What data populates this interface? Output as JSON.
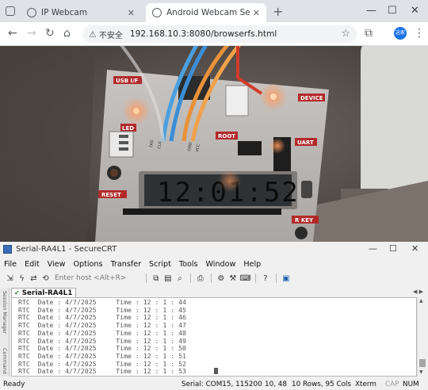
{
  "browser": {
    "tabs": [
      {
        "title": "IP Webcam",
        "active": false
      },
      {
        "title": "Android Webcam Server",
        "active": true
      }
    ],
    "url": "192.168.10.3:8080/browserfs.html",
    "security_label": "不安全",
    "avatar_text": "这家",
    "icons": {
      "back": "back-arrow-icon",
      "forward": "forward-arrow-icon",
      "reload": "reload-icon",
      "home": "home-icon",
      "bookmark": "star-icon",
      "extensions": "puzzle-icon",
      "menu": "kebab-menu-icon"
    }
  },
  "webcam": {
    "board_labels": {
      "usb": "USB I/F",
      "led": "LED",
      "device": "DEVICE",
      "root": "ROOT",
      "uart": "UART",
      "reset": "RESET",
      "key": "R KEY",
      "dio": "DIO",
      "clk": "CLK",
      "gnd": "GND",
      "vcc": "VCC"
    },
    "lcd_text": "12:01:52"
  },
  "crt": {
    "window_title": "Serial-RA4L1 - SecureCRT",
    "menu": [
      "File",
      "Edit",
      "View",
      "Options",
      "Transfer",
      "Script",
      "Tools",
      "Window",
      "Help"
    ],
    "host_placeholder": "Enter host <Alt+R>",
    "session_manager_label": "Session Manager",
    "command_manager_label": "Command",
    "session_tab": "Serial-RA4L1",
    "terminal_lines": [
      "RTC  Date : 4/7/2025     Time : 12 : 1 : 44",
      "RTC  Date : 4/7/2025     Time : 12 : 1 : 45",
      "RTC  Date : 4/7/2025     Time : 12 : 1 : 46",
      "RTC  Date : 4/7/2025     Time : 12 : 1 : 47",
      "RTC  Date : 4/7/2025     Time : 12 : 1 : 48",
      "RTC  Date : 4/7/2025     Time : 12 : 1 : 49",
      "RTC  Date : 4/7/2025     Time : 12 : 1 : 50",
      "RTC  Date : 4/7/2025     Time : 12 : 1 : 51",
      "RTC  Date : 4/7/2025     Time : 12 : 1 : 52",
      "RTC  Date : 4/7/2025     Time : 12 : 1 : 53"
    ],
    "status": {
      "ready": "Ready",
      "serial": "Serial: COM15, 115200",
      "position": "10,  48",
      "size": "10 Rows, 95 Cols",
      "emulation": "Xterm",
      "cap": "CAP",
      "num": "NUM"
    }
  }
}
